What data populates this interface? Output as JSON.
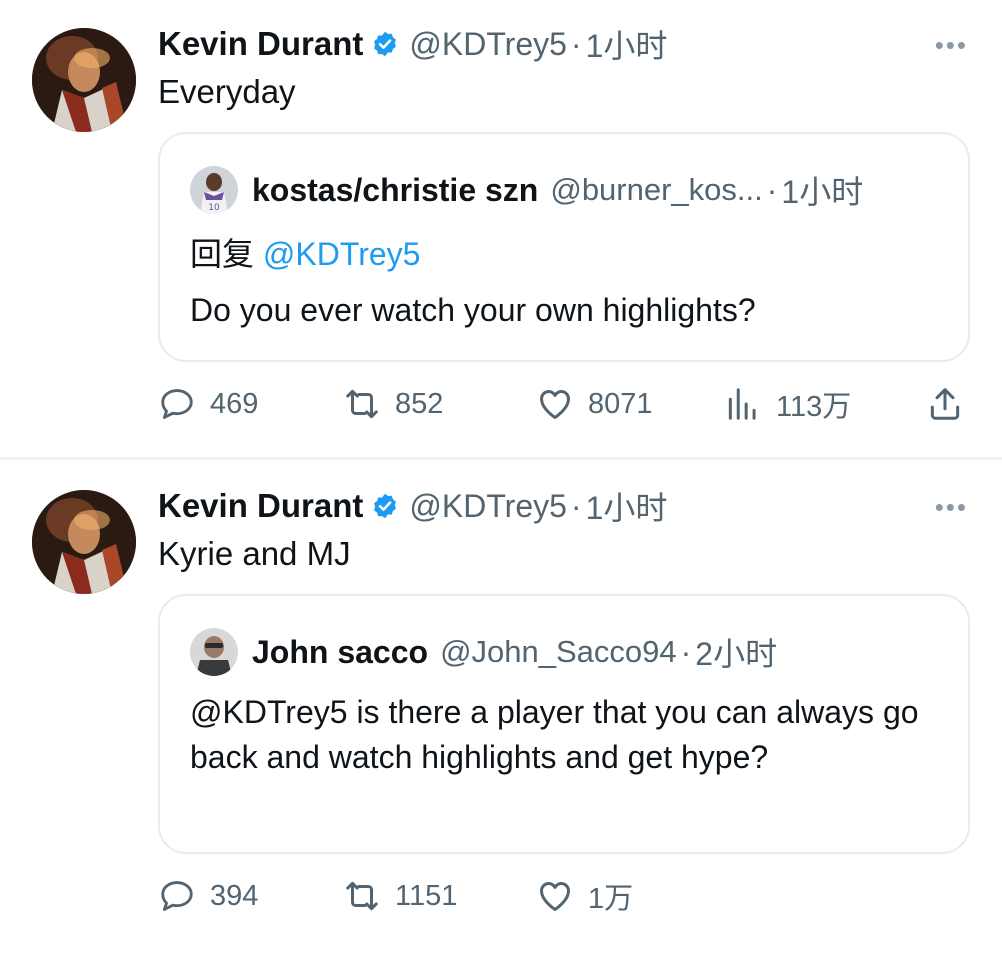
{
  "tweets": [
    {
      "author_name": "Kevin Durant",
      "handle": "@KDTrey5",
      "separator": "·",
      "time": "1小时",
      "text": "Everyday",
      "quote": {
        "author_name": "kostas/christie szn",
        "handle": "@burner_kos...",
        "separator": "·",
        "time": "1小时",
        "reply_prefix": "回复",
        "reply_to": "@KDTrey5",
        "text": "Do you ever watch your own highlights?"
      },
      "stats": {
        "replies": "469",
        "retweets": "852",
        "likes": "8071",
        "views": "113万"
      }
    },
    {
      "author_name": "Kevin Durant",
      "handle": "@KDTrey5",
      "separator": "·",
      "time": "1小时",
      "text": "Kyrie and MJ",
      "quote": {
        "author_name": "John sacco",
        "handle": "@John_Sacco94",
        "separator": "·",
        "time": "2小时",
        "text": "@KDTrey5 is there a player that you can always go back and watch highlights and get hype?"
      },
      "stats": {
        "replies": "394",
        "retweets": "1151",
        "likes": "1万"
      }
    }
  ],
  "icons": {
    "more": "more-horizontal-icon",
    "verified": "verified-badge-icon",
    "reply": "reply-bubble-icon",
    "retweet": "retweet-icon",
    "like": "heart-icon",
    "views": "views-bar-chart-icon",
    "share": "share-upload-icon"
  },
  "colors": {
    "accent": "#1d9bf0",
    "muted": "#536471",
    "border": "#e6ecf0",
    "text": "#0f1419"
  },
  "more_label": "•••"
}
